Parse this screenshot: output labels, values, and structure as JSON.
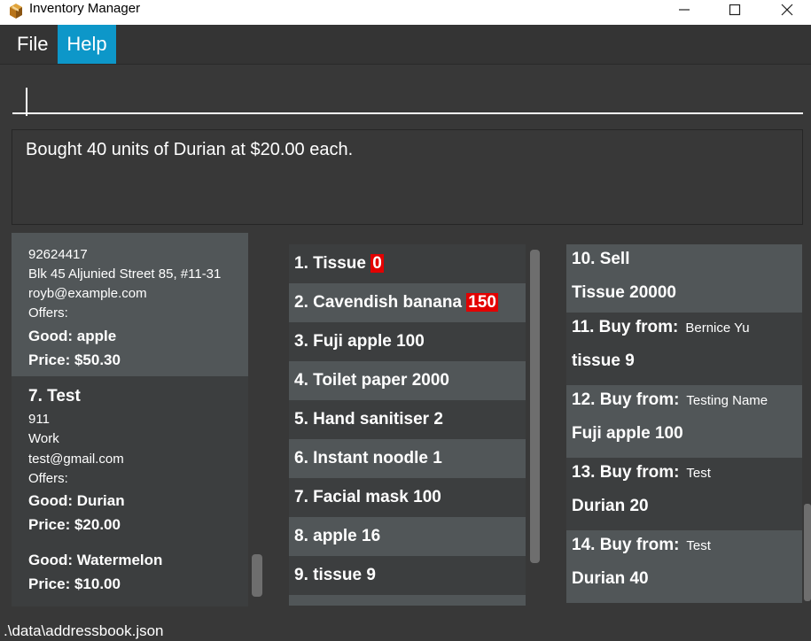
{
  "window": {
    "title": "Inventory Manager"
  },
  "menu": {
    "file": "File",
    "help": "Help"
  },
  "command": {
    "value": ""
  },
  "result": {
    "text": "Bought 40 units of Durian at $20.00 each."
  },
  "persons": {
    "partial": {
      "phone": "92624417",
      "address": "Blk 45 Aljunied Street 85, #11-31",
      "email": "royb@example.com",
      "offers_label": "Offers:",
      "good": "Good: apple",
      "price": "Price: $50.30"
    },
    "card7": {
      "title": "7.  Test",
      "phone": "911",
      "address": "Work",
      "email": "test@gmail.com",
      "offers_label": "Offers:",
      "good1": "Good: Durian",
      "price1": "Price: $20.00",
      "good2": "Good: Watermelon",
      "price2": "Price: $10.00"
    }
  },
  "inventory": [
    {
      "label": "1.  Tissue",
      "qty": "0",
      "low": true
    },
    {
      "label": "2.  Cavendish banana",
      "qty": "150",
      "low": true
    },
    {
      "label": "3.  Fuji apple",
      "qty": "100",
      "low": false
    },
    {
      "label": "4.  Toilet paper",
      "qty": "2000",
      "low": false
    },
    {
      "label": "5.  Hand sanitiser",
      "qty": "2",
      "low": false
    },
    {
      "label": "6.  Instant noodle",
      "qty": "1",
      "low": false
    },
    {
      "label": "7.  Facial mask",
      "qty": "100",
      "low": false
    },
    {
      "label": "8.  apple",
      "qty": "16",
      "low": false
    },
    {
      "label": "9.  tissue",
      "qty": "9",
      "low": false
    }
  ],
  "transactions": [
    {
      "head": "10.  Sell",
      "party": "",
      "detail": "Tissue 20000"
    },
    {
      "head": "11.  Buy from:",
      "party": "Bernice Yu",
      "detail": "tissue 9"
    },
    {
      "head": "12.  Buy from:",
      "party": "Testing Name",
      "detail": "Fuji apple 100"
    },
    {
      "head": "13.  Buy from:",
      "party": "Test",
      "detail": "Durian 20"
    },
    {
      "head": "14.  Buy from:",
      "party": "Test",
      "detail": "Durian 40"
    }
  ],
  "status": {
    "path": ".\\data\\addressbook.json"
  },
  "colors": {
    "accent": "#0d97c9",
    "low_stock": "#e30000",
    "bg": "#383838"
  }
}
